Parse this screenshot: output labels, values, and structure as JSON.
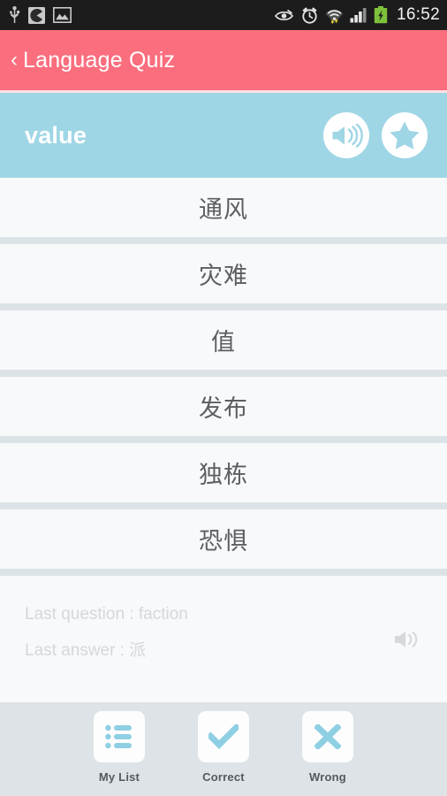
{
  "statusbar": {
    "time": "16:52",
    "left_icons": [
      "usb-icon",
      "pacman-app-icon",
      "image-icon"
    ],
    "right_icons": [
      "eye-icon",
      "alarm-clock-icon",
      "wifi-icon",
      "signal-bars-icon",
      "battery-charging-icon"
    ]
  },
  "titlebar": {
    "back_label": "‹",
    "title": "Language Quiz",
    "background_color": "#fa6e7e"
  },
  "question": {
    "word": "value",
    "background_color": "#9fd6e5",
    "speaker_icon": "speaker-icon",
    "star_icon": "star-icon"
  },
  "answers": [
    {
      "text": "通风"
    },
    {
      "text": "灾难"
    },
    {
      "text": "值"
    },
    {
      "text": "发布"
    },
    {
      "text": "独栋"
    },
    {
      "text": "恐惧"
    }
  ],
  "last": {
    "question": "Last question : faction",
    "answer": "Last answer : 派",
    "speaker_icon": "speaker-icon"
  },
  "bottom_nav": [
    {
      "label": "My List",
      "icon": "list-icon"
    },
    {
      "label": "Correct",
      "icon": "check-icon"
    },
    {
      "label": "Wrong",
      "icon": "cross-icon"
    }
  ]
}
